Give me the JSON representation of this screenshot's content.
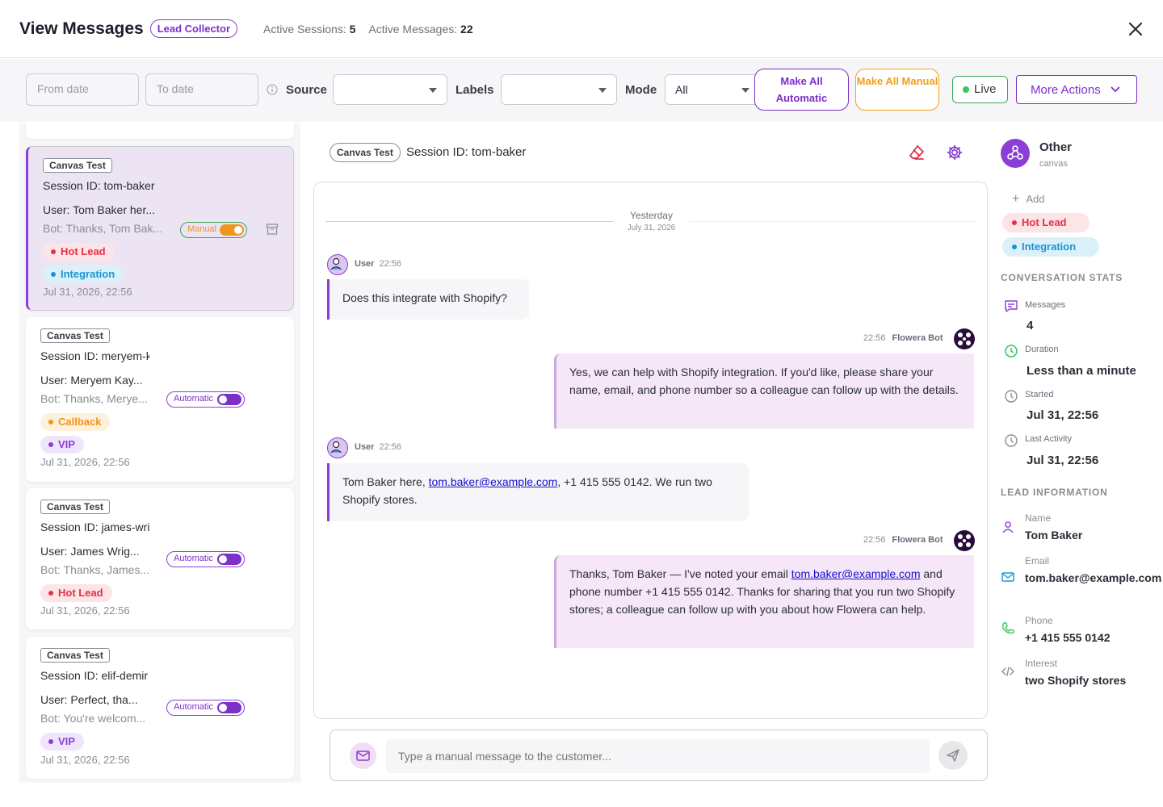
{
  "header": {
    "title": "View Messages",
    "badge": "Lead Collector",
    "active_sessions_label": "Active Sessions:",
    "active_sessions_value": "5",
    "active_messages_label": "Active Messages:",
    "active_messages_value": "22"
  },
  "filters": {
    "from_date_placeholder": "From date",
    "to_date_placeholder": "To date",
    "source_label": "Source",
    "labels_label": "Labels",
    "mode_label": "Mode",
    "mode_value": "All",
    "make_all_automatic": "Make All Automatic",
    "make_all_manual": "Make All Manual",
    "live": "Live",
    "more_actions": "More Actions"
  },
  "sessions": [
    {
      "tag": "Canvas Test",
      "session": "Session ID: tom-baker",
      "user": "User: Tom Baker her...",
      "bot": "Bot: Thanks, Tom Bak...",
      "mode": "Manual",
      "labels": [
        "Hot Lead",
        "Integration"
      ],
      "date": "Jul 31, 2026, 22:56"
    },
    {
      "tag": "Canvas Test",
      "session": "Session ID: meryem-k",
      "user": "User: Meryem Kay...",
      "bot": "Bot: Thanks, Merye...",
      "mode": "Automatic",
      "labels": [
        "Callback",
        "VIP"
      ],
      "date": "Jul 31, 2026, 22:56"
    },
    {
      "tag": "Canvas Test",
      "session": "Session ID: james-wri",
      "user": "User: James Wrig...",
      "bot": "Bot: Thanks, James...",
      "mode": "Automatic",
      "labels": [
        "Hot Lead"
      ],
      "date": "Jul 31, 2026, 22:56"
    },
    {
      "tag": "Canvas Test",
      "session": "Session ID: elif-demir",
      "user": "User: Perfect, tha...",
      "bot": "Bot: You're welcom...",
      "mode": "Automatic",
      "labels": [
        "VIP"
      ],
      "date": "Jul 31, 2026, 22:56"
    }
  ],
  "chat": {
    "tag": "Canvas Test",
    "session": "Session ID: tom-baker",
    "day": "Yesterday",
    "date": "July 31, 2026",
    "messages": [
      {
        "sender": "User",
        "time": "22:56",
        "text": "Does this integrate with Shopify?"
      },
      {
        "sender": "Flowera Bot",
        "time": "22:56",
        "text": "Yes, we can help with Shopify integration. If you'd like, please share your name, email, and phone number so a colleague can follow up with the details."
      },
      {
        "sender": "User",
        "time": "22:56",
        "text_before": "Tom Baker here, ",
        "link": "tom.baker@example.com",
        "text_after": ", +1 415 555 0142. We run two Shopify stores."
      },
      {
        "sender": "Flowera Bot",
        "time": "22:56",
        "text_before": "Thanks, Tom Baker — I've noted your email ",
        "link": "tom.baker@example.com",
        "text_after": " and phone number +1 415 555 0142. Thanks for sharing that you run two Shopify stores; a colleague can follow up with you about how Flowera can help."
      }
    ],
    "composer_placeholder": "Type a manual message to the customer..."
  },
  "sidebar": {
    "source_title": "Other",
    "source_sub": "canvas",
    "add": "Add",
    "labels": [
      "Hot Lead",
      "Integration"
    ],
    "stats_title": "CONVERSATION STATS",
    "stats": [
      {
        "label": "Messages",
        "value": "4"
      },
      {
        "label": "Duration",
        "value": "Less than a minute"
      },
      {
        "label": "Started",
        "value": "Jul 31, 22:56"
      },
      {
        "label": "Last Activity",
        "value": "Jul 31, 22:56"
      }
    ],
    "lead_title": "LEAD INFORMATION",
    "lead": [
      {
        "label": "Name",
        "value": "Tom Baker"
      },
      {
        "label": "Email",
        "value": "tom.baker@example.com"
      },
      {
        "label": "Phone",
        "value": "+1 415 555 0142"
      },
      {
        "label": "Interest",
        "value": "two Shopify stores"
      }
    ]
  }
}
